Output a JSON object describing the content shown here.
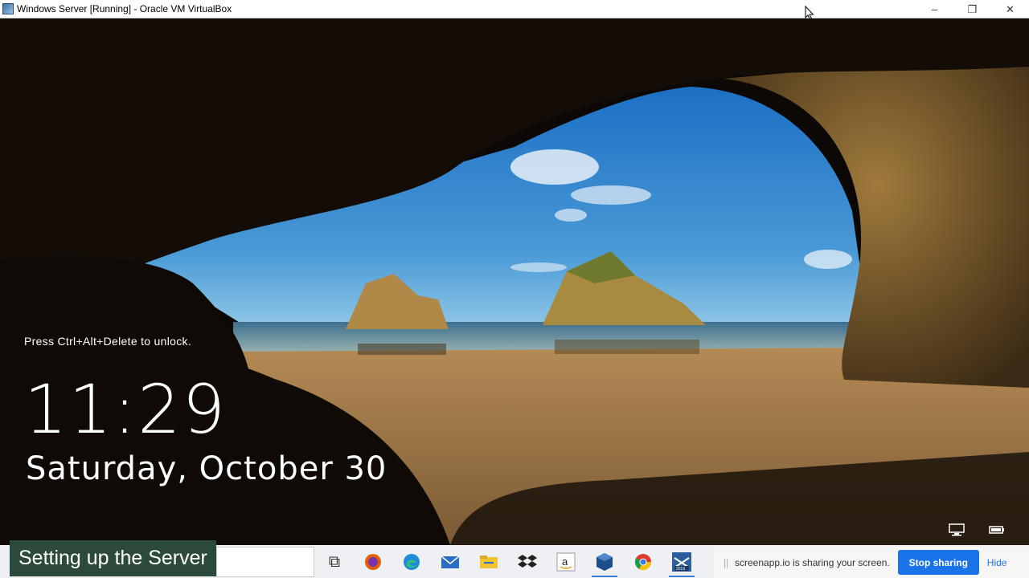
{
  "window": {
    "title": "Windows Server [Running] - Oracle VM VirtualBox",
    "minimize_icon": "–",
    "restore_icon": "❐",
    "close_icon": "✕"
  },
  "lockscreen": {
    "hint": "Press Ctrl+Alt+Delete to unlock.",
    "time": "11:29",
    "date": "Saturday, October 30",
    "icons": [
      "network-icon",
      "power-status-icon"
    ]
  },
  "overlay": {
    "caption": "Setting up the Server"
  },
  "taskbar": {
    "apps": [
      {
        "name": "task-view-icon",
        "glyph": "⧉"
      },
      {
        "name": "firefox-icon",
        "glyph": "●",
        "color": "#e66000"
      },
      {
        "name": "edge-icon",
        "glyph": "●",
        "color": "#1f8ad8"
      },
      {
        "name": "mail-icon",
        "glyph": "✉",
        "color": "#2b6cc4"
      },
      {
        "name": "file-explorer-icon",
        "glyph": "▬",
        "color": "#f2c230"
      },
      {
        "name": "dropbox-icon",
        "glyph": "❖",
        "color": "#222"
      },
      {
        "name": "amazon-icon",
        "glyph": "a",
        "color": "#333"
      },
      {
        "name": "virtualbox-icon",
        "glyph": "⬢",
        "color": "#1e4f8c"
      },
      {
        "name": "chrome-icon",
        "glyph": "◉",
        "color": "#dd3a2c"
      },
      {
        "name": "server-2019-icon",
        "glyph": "▣",
        "color": "#2c5e9c"
      }
    ]
  },
  "share": {
    "grip": "||",
    "text": "screenapp.io is sharing your screen.",
    "stop_label": "Stop sharing",
    "hide_label": "Hide"
  }
}
